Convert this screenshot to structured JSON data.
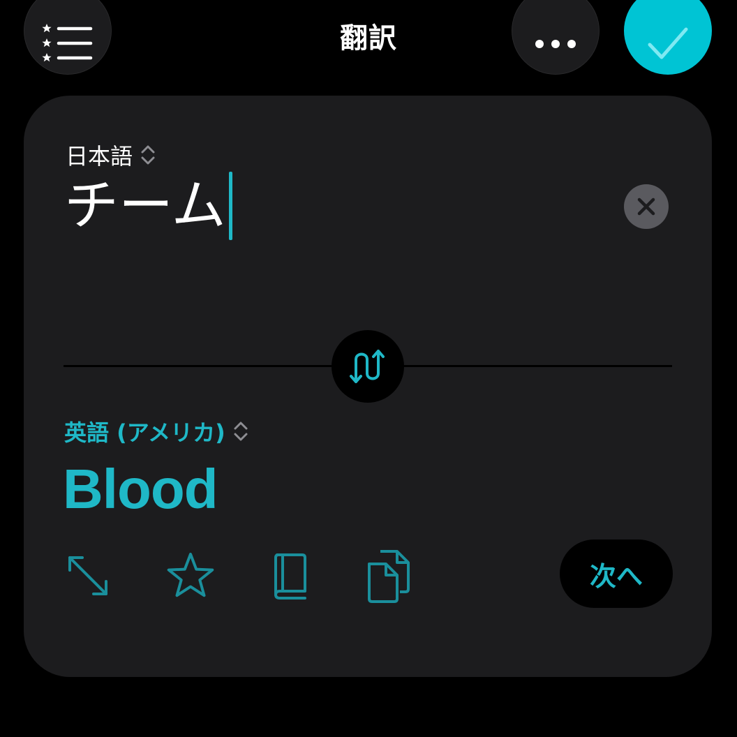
{
  "header": {
    "title": "翻訳",
    "list_icon": "starred-list-icon",
    "more_icon": "ellipsis-icon",
    "done_icon": "checkmark-icon"
  },
  "source": {
    "language": "日本語",
    "text": "チーム",
    "clear_icon": "xmark-icon"
  },
  "swap_icon": "swap-arrows-icon",
  "target": {
    "language": "英語 (アメリカ)",
    "text": "Blood"
  },
  "actions": {
    "expand_icon": "expand-arrows-icon",
    "favorite_icon": "star-icon",
    "dictionary_icon": "book-icon",
    "copy_icon": "copy-icon",
    "next_label": "次へ"
  },
  "colors": {
    "accent": "#00c4d4",
    "text_accent": "#1fb8c7",
    "card": "#1c1c1e",
    "background": "#000000"
  }
}
